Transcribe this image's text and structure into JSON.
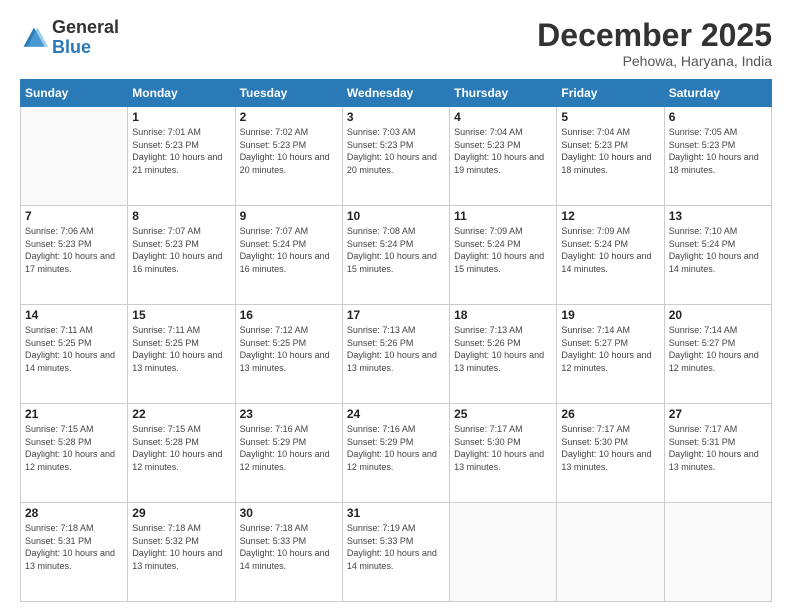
{
  "header": {
    "logo_general": "General",
    "logo_blue": "Blue",
    "title": "December 2025",
    "subtitle": "Pehowa, Haryana, India"
  },
  "weekdays": [
    "Sunday",
    "Monday",
    "Tuesday",
    "Wednesday",
    "Thursday",
    "Friday",
    "Saturday"
  ],
  "weeks": [
    [
      {
        "day": "",
        "sunrise": "",
        "sunset": "",
        "daylight": ""
      },
      {
        "day": "1",
        "sunrise": "Sunrise: 7:01 AM",
        "sunset": "Sunset: 5:23 PM",
        "daylight": "Daylight: 10 hours and 21 minutes."
      },
      {
        "day": "2",
        "sunrise": "Sunrise: 7:02 AM",
        "sunset": "Sunset: 5:23 PM",
        "daylight": "Daylight: 10 hours and 20 minutes."
      },
      {
        "day": "3",
        "sunrise": "Sunrise: 7:03 AM",
        "sunset": "Sunset: 5:23 PM",
        "daylight": "Daylight: 10 hours and 20 minutes."
      },
      {
        "day": "4",
        "sunrise": "Sunrise: 7:04 AM",
        "sunset": "Sunset: 5:23 PM",
        "daylight": "Daylight: 10 hours and 19 minutes."
      },
      {
        "day": "5",
        "sunrise": "Sunrise: 7:04 AM",
        "sunset": "Sunset: 5:23 PM",
        "daylight": "Daylight: 10 hours and 18 minutes."
      },
      {
        "day": "6",
        "sunrise": "Sunrise: 7:05 AM",
        "sunset": "Sunset: 5:23 PM",
        "daylight": "Daylight: 10 hours and 18 minutes."
      }
    ],
    [
      {
        "day": "7",
        "sunrise": "Sunrise: 7:06 AM",
        "sunset": "Sunset: 5:23 PM",
        "daylight": "Daylight: 10 hours and 17 minutes."
      },
      {
        "day": "8",
        "sunrise": "Sunrise: 7:07 AM",
        "sunset": "Sunset: 5:23 PM",
        "daylight": "Daylight: 10 hours and 16 minutes."
      },
      {
        "day": "9",
        "sunrise": "Sunrise: 7:07 AM",
        "sunset": "Sunset: 5:24 PM",
        "daylight": "Daylight: 10 hours and 16 minutes."
      },
      {
        "day": "10",
        "sunrise": "Sunrise: 7:08 AM",
        "sunset": "Sunset: 5:24 PM",
        "daylight": "Daylight: 10 hours and 15 minutes."
      },
      {
        "day": "11",
        "sunrise": "Sunrise: 7:09 AM",
        "sunset": "Sunset: 5:24 PM",
        "daylight": "Daylight: 10 hours and 15 minutes."
      },
      {
        "day": "12",
        "sunrise": "Sunrise: 7:09 AM",
        "sunset": "Sunset: 5:24 PM",
        "daylight": "Daylight: 10 hours and 14 minutes."
      },
      {
        "day": "13",
        "sunrise": "Sunrise: 7:10 AM",
        "sunset": "Sunset: 5:24 PM",
        "daylight": "Daylight: 10 hours and 14 minutes."
      }
    ],
    [
      {
        "day": "14",
        "sunrise": "Sunrise: 7:11 AM",
        "sunset": "Sunset: 5:25 PM",
        "daylight": "Daylight: 10 hours and 14 minutes."
      },
      {
        "day": "15",
        "sunrise": "Sunrise: 7:11 AM",
        "sunset": "Sunset: 5:25 PM",
        "daylight": "Daylight: 10 hours and 13 minutes."
      },
      {
        "day": "16",
        "sunrise": "Sunrise: 7:12 AM",
        "sunset": "Sunset: 5:25 PM",
        "daylight": "Daylight: 10 hours and 13 minutes."
      },
      {
        "day": "17",
        "sunrise": "Sunrise: 7:13 AM",
        "sunset": "Sunset: 5:26 PM",
        "daylight": "Daylight: 10 hours and 13 minutes."
      },
      {
        "day": "18",
        "sunrise": "Sunrise: 7:13 AM",
        "sunset": "Sunset: 5:26 PM",
        "daylight": "Daylight: 10 hours and 13 minutes."
      },
      {
        "day": "19",
        "sunrise": "Sunrise: 7:14 AM",
        "sunset": "Sunset: 5:27 PM",
        "daylight": "Daylight: 10 hours and 12 minutes."
      },
      {
        "day": "20",
        "sunrise": "Sunrise: 7:14 AM",
        "sunset": "Sunset: 5:27 PM",
        "daylight": "Daylight: 10 hours and 12 minutes."
      }
    ],
    [
      {
        "day": "21",
        "sunrise": "Sunrise: 7:15 AM",
        "sunset": "Sunset: 5:28 PM",
        "daylight": "Daylight: 10 hours and 12 minutes."
      },
      {
        "day": "22",
        "sunrise": "Sunrise: 7:15 AM",
        "sunset": "Sunset: 5:28 PM",
        "daylight": "Daylight: 10 hours and 12 minutes."
      },
      {
        "day": "23",
        "sunrise": "Sunrise: 7:16 AM",
        "sunset": "Sunset: 5:29 PM",
        "daylight": "Daylight: 10 hours and 12 minutes."
      },
      {
        "day": "24",
        "sunrise": "Sunrise: 7:16 AM",
        "sunset": "Sunset: 5:29 PM",
        "daylight": "Daylight: 10 hours and 12 minutes."
      },
      {
        "day": "25",
        "sunrise": "Sunrise: 7:17 AM",
        "sunset": "Sunset: 5:30 PM",
        "daylight": "Daylight: 10 hours and 13 minutes."
      },
      {
        "day": "26",
        "sunrise": "Sunrise: 7:17 AM",
        "sunset": "Sunset: 5:30 PM",
        "daylight": "Daylight: 10 hours and 13 minutes."
      },
      {
        "day": "27",
        "sunrise": "Sunrise: 7:17 AM",
        "sunset": "Sunset: 5:31 PM",
        "daylight": "Daylight: 10 hours and 13 minutes."
      }
    ],
    [
      {
        "day": "28",
        "sunrise": "Sunrise: 7:18 AM",
        "sunset": "Sunset: 5:31 PM",
        "daylight": "Daylight: 10 hours and 13 minutes."
      },
      {
        "day": "29",
        "sunrise": "Sunrise: 7:18 AM",
        "sunset": "Sunset: 5:32 PM",
        "daylight": "Daylight: 10 hours and 13 minutes."
      },
      {
        "day": "30",
        "sunrise": "Sunrise: 7:18 AM",
        "sunset": "Sunset: 5:33 PM",
        "daylight": "Daylight: 10 hours and 14 minutes."
      },
      {
        "day": "31",
        "sunrise": "Sunrise: 7:19 AM",
        "sunset": "Sunset: 5:33 PM",
        "daylight": "Daylight: 10 hours and 14 minutes."
      },
      {
        "day": "",
        "sunrise": "",
        "sunset": "",
        "daylight": ""
      },
      {
        "day": "",
        "sunrise": "",
        "sunset": "",
        "daylight": ""
      },
      {
        "day": "",
        "sunrise": "",
        "sunset": "",
        "daylight": ""
      }
    ]
  ]
}
